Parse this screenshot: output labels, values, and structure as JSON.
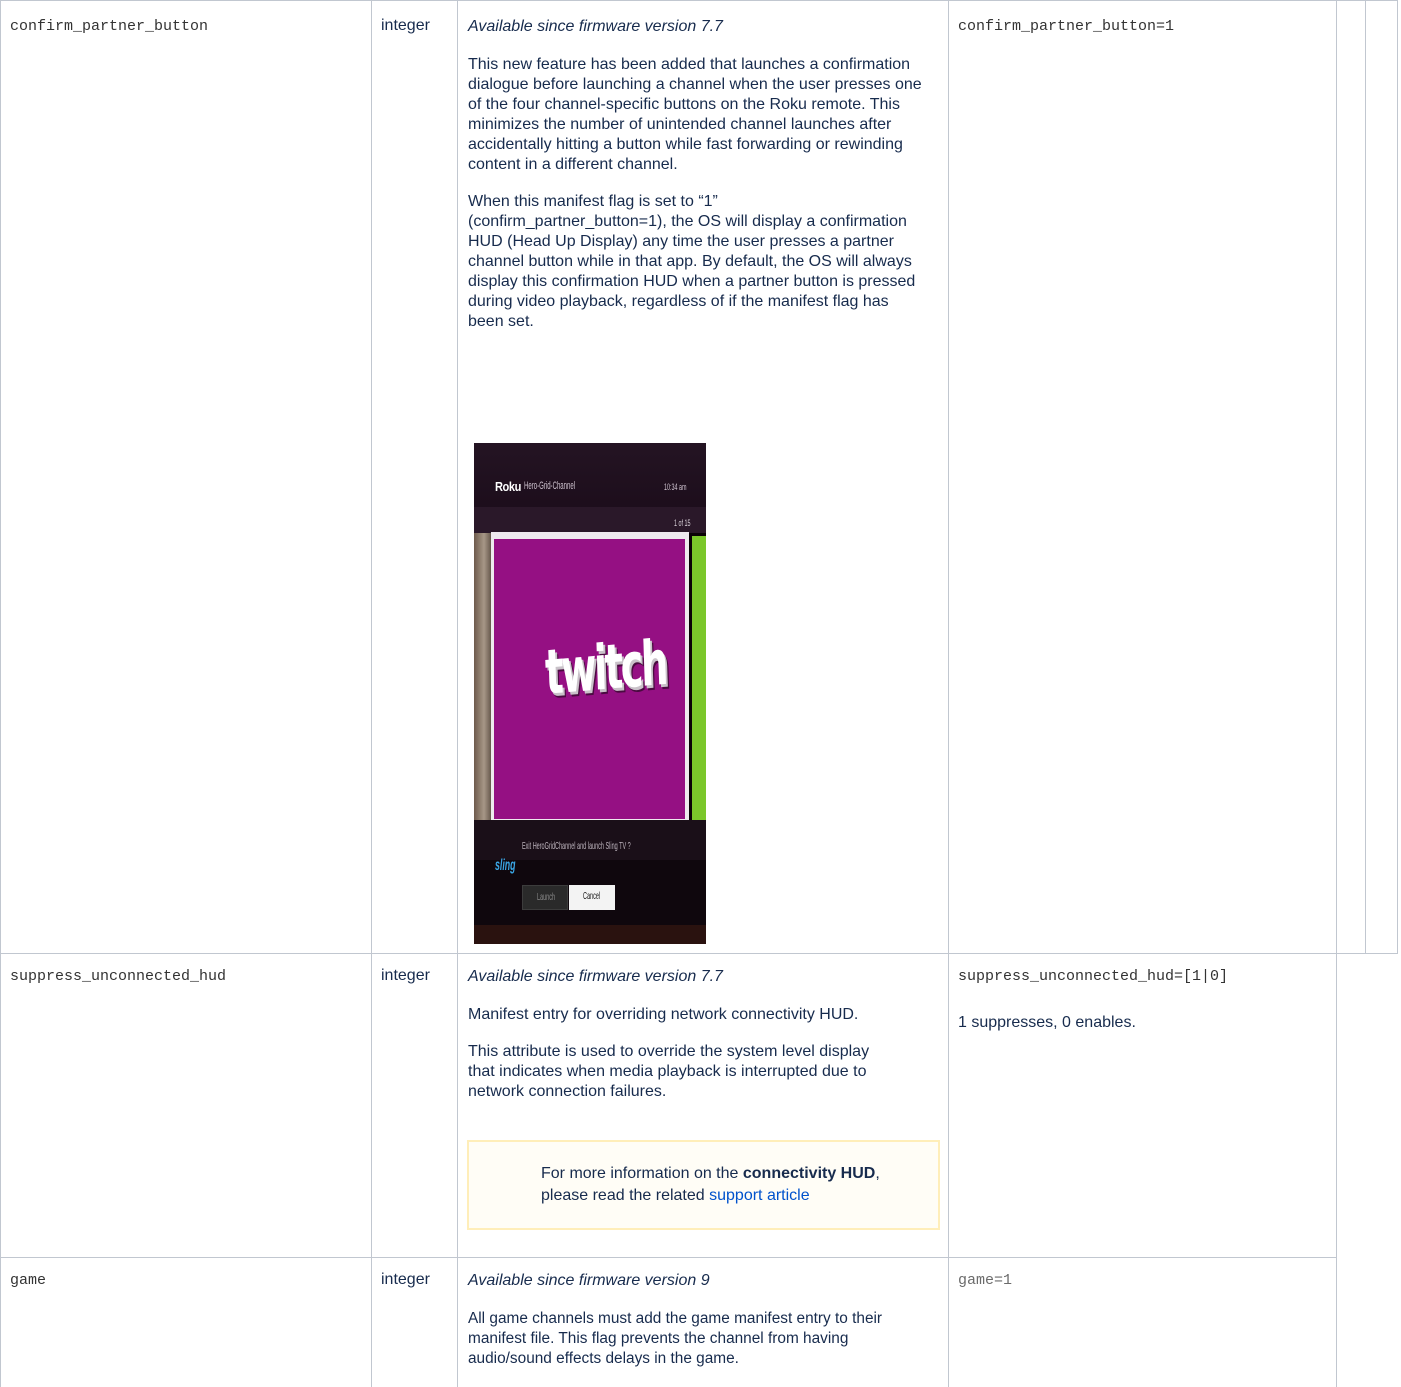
{
  "rows": [
    {
      "attribute": "confirm_partner_button",
      "type": "integer",
      "availability": "Available since firmware version 7.7",
      "paragraphs": [
        "This new feature has been added that launches a confirmation dialogue before launching a channel when the user presses one of the four channel-specific buttons on the Roku remote. This minimizes the number of unintended channel launches after accidentally hitting a button while fast forwarding or rewinding content in a different channel.",
        "When this manifest flag is set to “1” (confirm_partner_button=1), the OS will display a confirmation HUD (Head Up Display) any time the user presses a partner channel button while in that app. By default, the OS will always display this confirmation HUD when a partner button is pressed during video playback, regardless of if the manifest flag has been set."
      ],
      "example": "confirm_partner_button=1",
      "screenshot": {
        "brand": "Roku",
        "channel": "Hero-Grid-Channel",
        "time": "10:34 am",
        "counter": "1 of 15",
        "tile_logo": "twitch",
        "question": "Exit HeroGridChannel and launch Sling TV ?",
        "partner_logo": "sling",
        "launch_label": "Launch",
        "cancel_label": "Cancel"
      }
    },
    {
      "attribute": "suppress_unconnected_hud",
      "type": "integer",
      "availability": "Available since firmware version 7.7",
      "paragraphs": [
        "Manifest entry for overriding network connectivity HUD.",
        "This attribute is used to override the system level display that indicates when media playback is interrupted due to network connection failures."
      ],
      "note": {
        "prefix": "For more information on the ",
        "bold": "connectivity HUD",
        "middle": ", please read the related ",
        "link": "support article"
      },
      "example": "suppress_unconnected_hud=[1|0]",
      "example_note": "1 suppresses, 0 enables."
    },
    {
      "attribute": "game",
      "type": "integer",
      "availability": "Available since firmware version 9",
      "paragraphs": [
        "All game channels must add the game manifest entry to their manifest file. This flag prevents the channel from having audio/sound effects delays in the game."
      ],
      "example": "game=1"
    }
  ]
}
